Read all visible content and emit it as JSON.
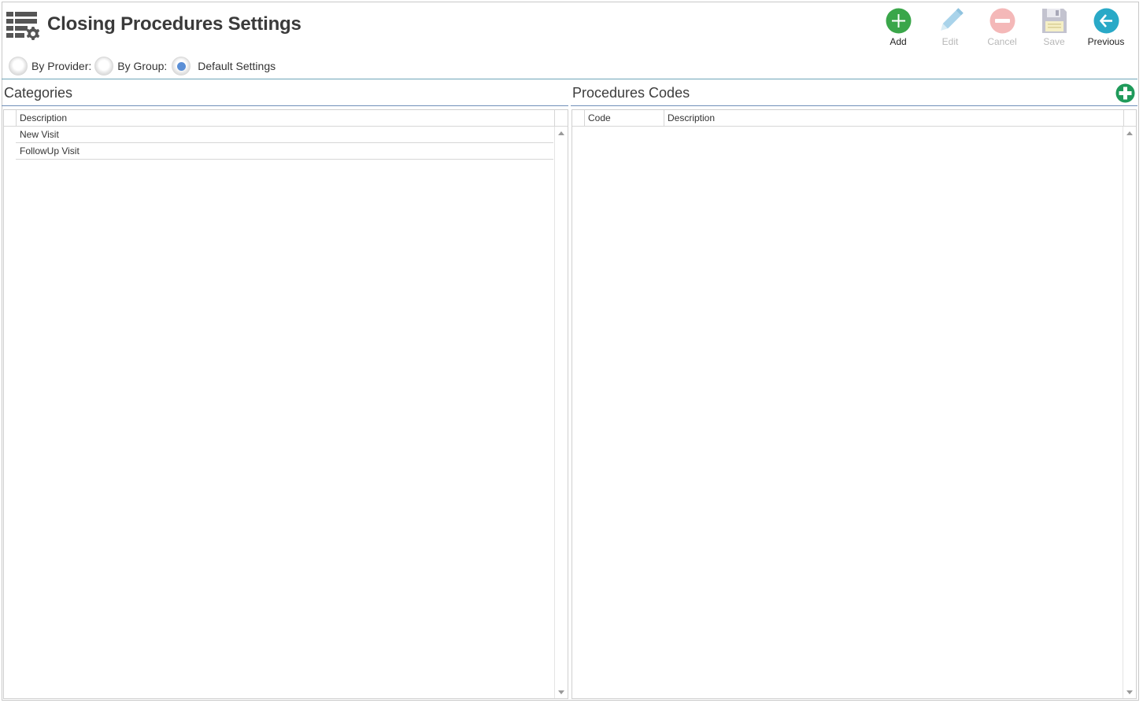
{
  "header": {
    "title": "Closing Procedures Settings",
    "title_icon": "list-settings-icon"
  },
  "filters": {
    "options": [
      {
        "label": "By Provider:",
        "checked": false
      },
      {
        "label": "By Group:",
        "checked": false
      },
      {
        "label": "Default Settings",
        "checked": true
      }
    ]
  },
  "toolbar": {
    "add": {
      "label": "Add",
      "icon": "add-icon",
      "enabled": true,
      "color": "#3aa64a"
    },
    "edit": {
      "label": "Edit",
      "icon": "pencil-icon",
      "enabled": false,
      "color": "#a9d3ea"
    },
    "cancel": {
      "label": "Cancel",
      "icon": "cancel-icon",
      "enabled": false,
      "color": "#f2b1b1"
    },
    "save": {
      "label": "Save",
      "icon": "save-icon",
      "enabled": false,
      "color": "#b9b9c9"
    },
    "previous": {
      "label": "Previous",
      "icon": "back-arrow-icon",
      "enabled": true,
      "color": "#29a9c7"
    }
  },
  "categories": {
    "title": "Categories",
    "columns": [
      "Description"
    ],
    "rows": [
      "New Visit",
      "FollowUp Visit"
    ]
  },
  "procedures": {
    "title": "Procedures Codes",
    "add_icon": "add-circle-icon",
    "columns": [
      "Code",
      "Description"
    ],
    "rows": []
  }
}
